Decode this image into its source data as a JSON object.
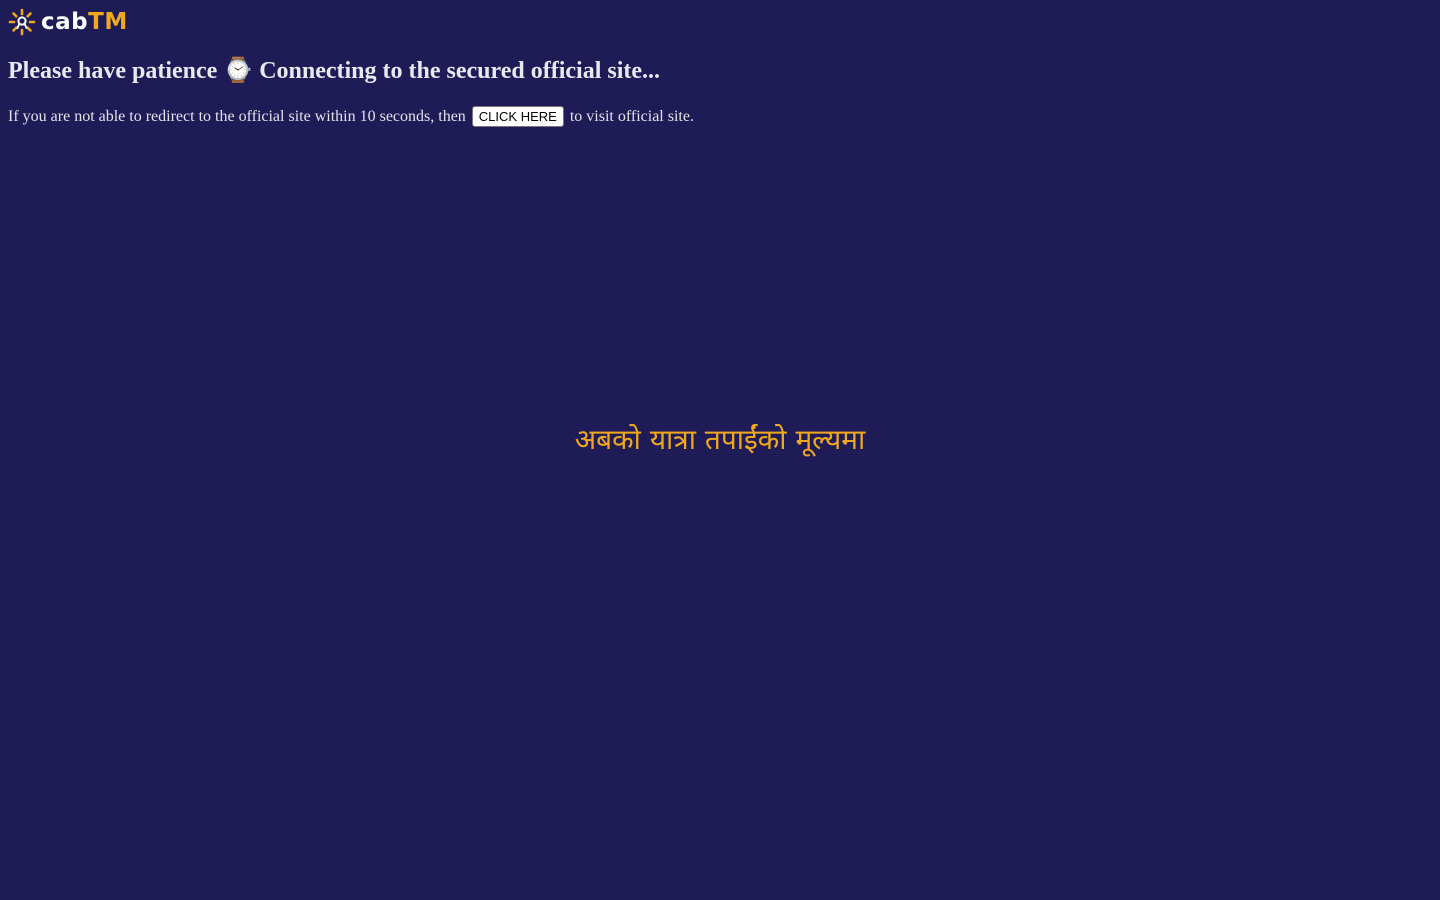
{
  "logo": {
    "brand_part1": "cab",
    "brand_part2": "TM",
    "icon": "sun-logo-icon",
    "accent_color": "#f0a81e"
  },
  "heading": {
    "text_before": "Please have patience",
    "emoji": "⌚",
    "text_after": "Connecting to the secured official site..."
  },
  "redirect": {
    "prefix": "If you are not able to redirect to the official site within 10 seconds, then",
    "button_label": "CLICK HERE",
    "suffix": "to visit official site."
  },
  "tagline": "अबको यात्रा तपाईंको मूल्यमा",
  "colors": {
    "background": "#1e1b57",
    "accent": "#f0a81e",
    "text": "#ffffff"
  }
}
